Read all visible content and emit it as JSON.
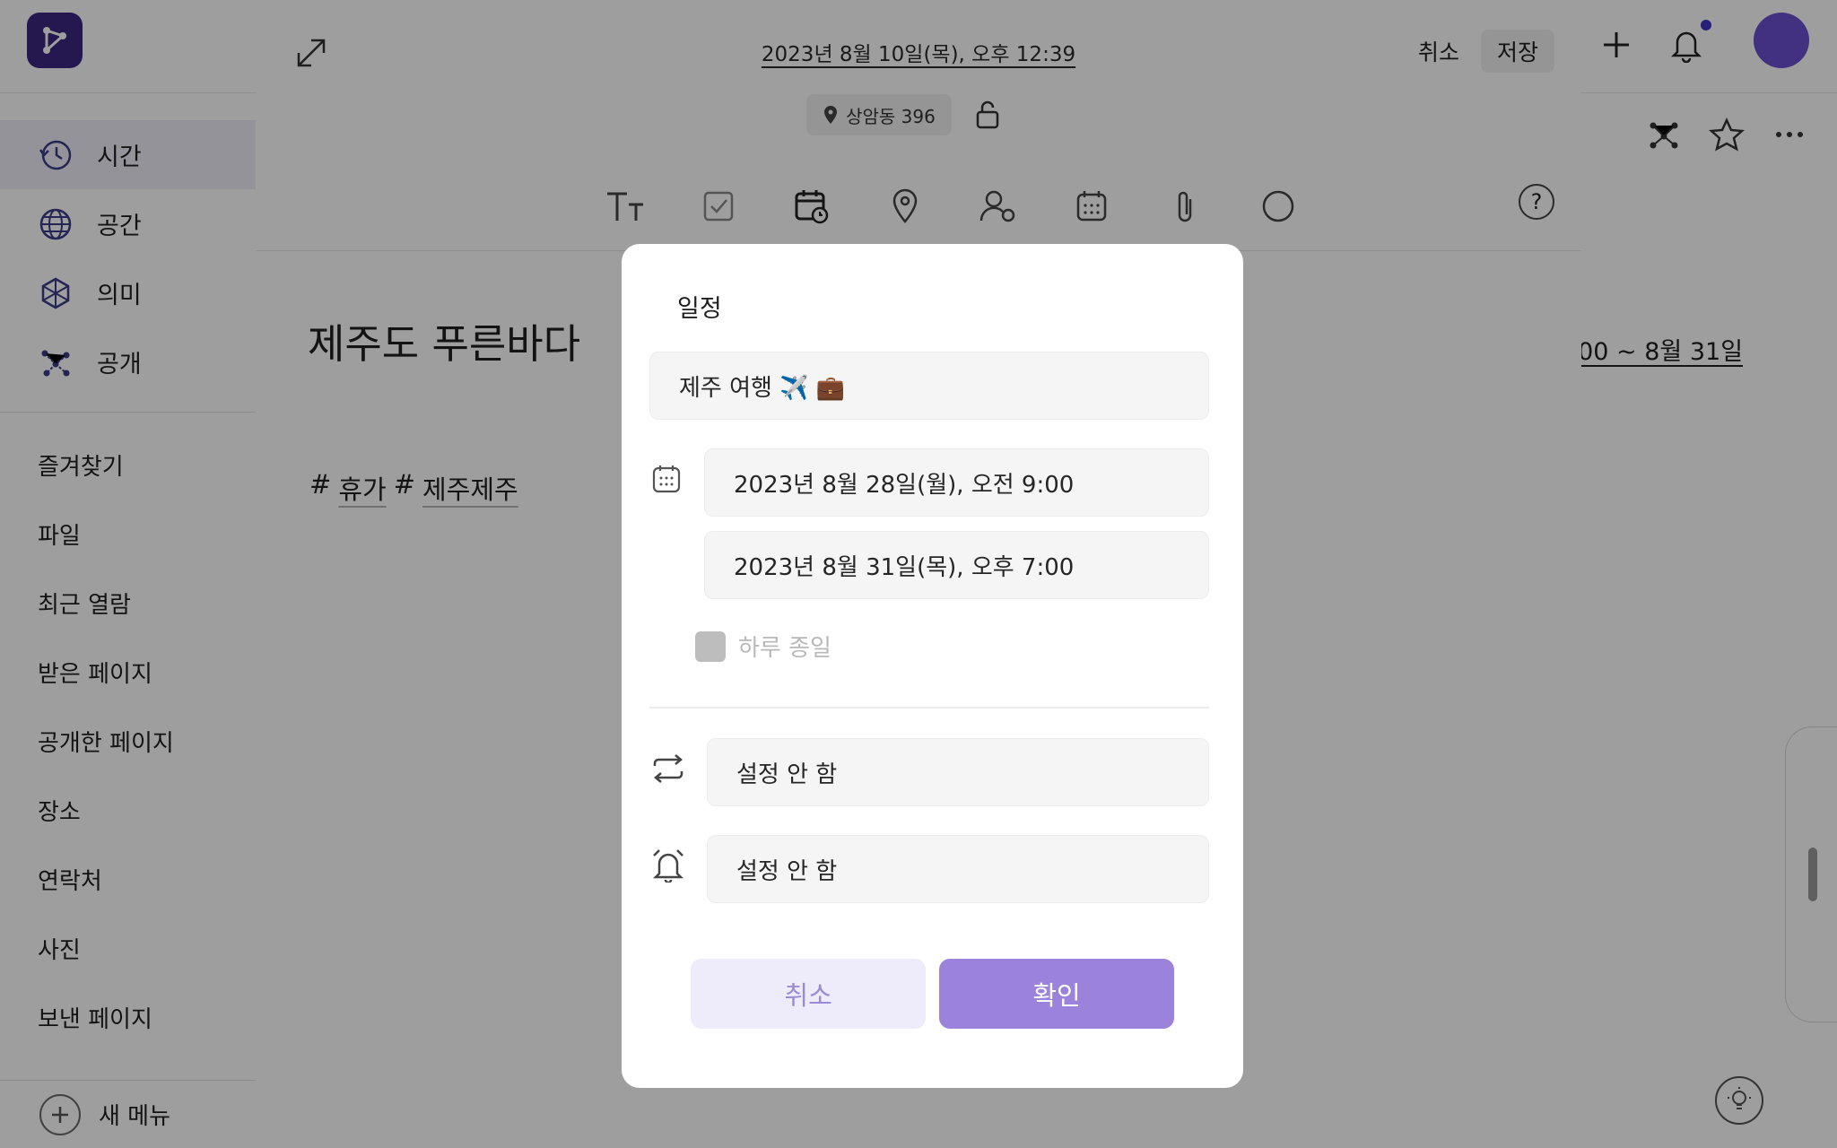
{
  "sidebar": {
    "nav": [
      {
        "label": "시간",
        "icon": "history-icon"
      },
      {
        "label": "공간",
        "icon": "globe-icon"
      },
      {
        "label": "의미",
        "icon": "sparkle-network-icon"
      },
      {
        "label": "공개",
        "icon": "share-network-icon"
      }
    ],
    "sub": [
      "즐겨찾기",
      "파일",
      "최근 열람",
      "받은 페이지",
      "공개한 페이지",
      "장소",
      "연락처",
      "사진",
      "보낸 페이지"
    ],
    "new_menu": "새 메뉴"
  },
  "background_right": {
    "date_range_fragment": ":00 ~ 8월 31일"
  },
  "editor": {
    "datetime": "2023년 8월 10일(목), 오후 12:39",
    "cancel": "취소",
    "save": "저장",
    "location": "상암동 396",
    "title": "제주도 푸른바다",
    "tags": [
      "휴가",
      "제주제주"
    ],
    "tag_prefix": "#",
    "help": "?",
    "toolbar_icons": [
      "text-size-icon",
      "checkbox-icon",
      "calendar-clock-icon",
      "location-pin-icon",
      "contact-icon",
      "calendar-grid-icon",
      "paperclip-icon",
      "circle-icon"
    ]
  },
  "dialog": {
    "header": "일정",
    "title_value": "제주 여행 ✈️ 💼",
    "start": "2023년 8월 28일(월), 오전 9:00",
    "end": "2023년 8월 31일(목), 오후 7:00",
    "all_day_label": "하루 종일",
    "all_day_checked": false,
    "repeat_value": "설정 안 함",
    "alarm_value": "설정 안 함",
    "cancel_button": "취소",
    "confirm_button": "확인"
  },
  "colors": {
    "accent": "#9b83db",
    "accent_light": "#eeebfa",
    "brand_dark": "#3d2680"
  }
}
